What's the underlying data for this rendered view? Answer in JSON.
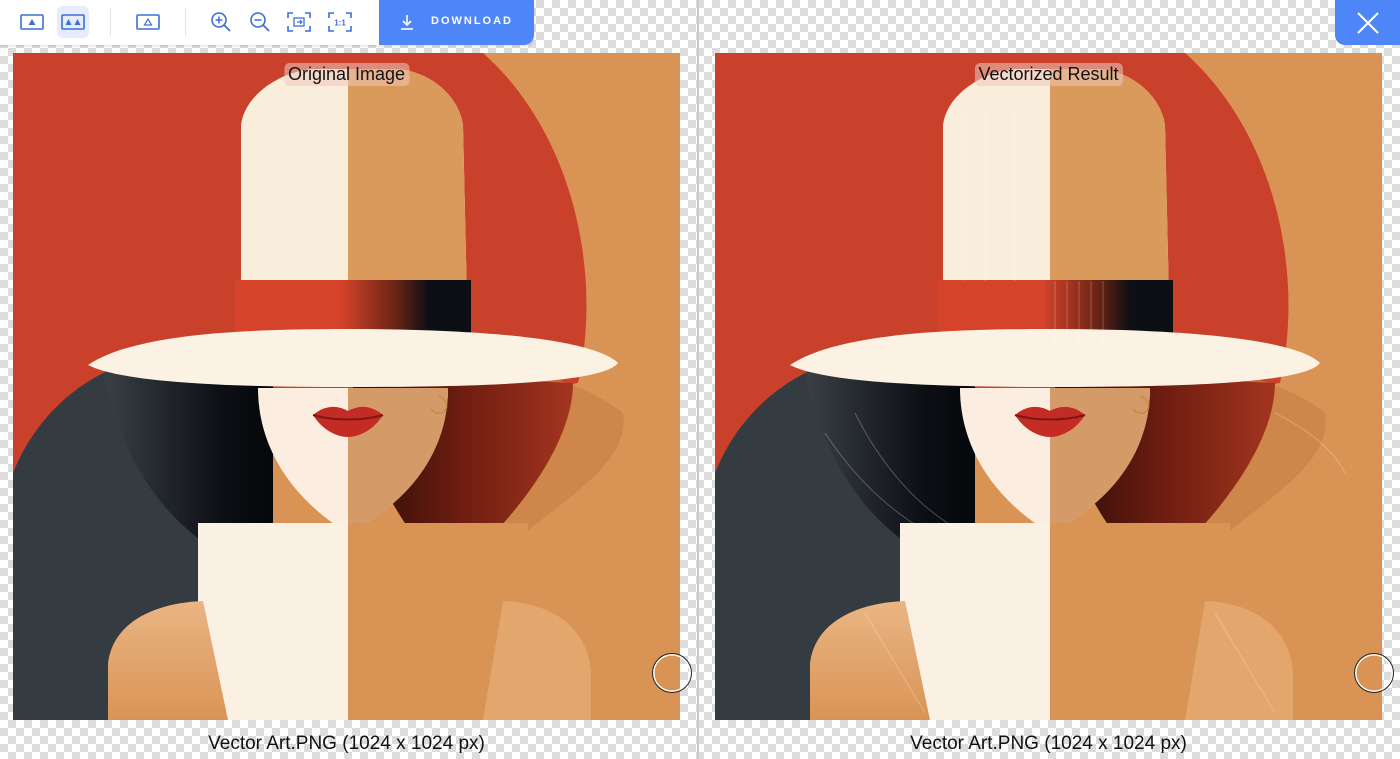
{
  "toolbar": {
    "icons": [
      "single-view-icon",
      "side-by-side-view-icon",
      "outline-view-icon",
      "zoom-in-icon",
      "zoom-out-icon",
      "fit-to-screen-icon",
      "actual-size-icon"
    ],
    "actual_size_label": "1:1",
    "download_label": "DOWNLOAD"
  },
  "close_icon": "close-icon",
  "panels": {
    "left": {
      "label": "Original Image",
      "caption": "Vector Art.PNG (1024 x 1024 px)"
    },
    "right": {
      "label": "Vectorized Result",
      "caption": "Vector Art.PNG (1024 x 1024 px)"
    }
  },
  "colors": {
    "accent": "#4f86f7",
    "background_orange": "#d99455",
    "red": "#c9412a",
    "hat_cream": "#f9eedc",
    "dark_slate": "#343c41",
    "hair_dark": "#5a1a12",
    "lips": "#c42b24"
  }
}
